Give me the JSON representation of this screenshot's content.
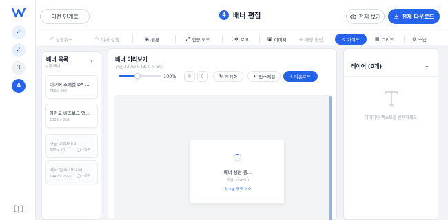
{
  "rail": {
    "steps": [
      {
        "label": "✓",
        "state": "done"
      },
      {
        "label": "✓",
        "state": "done"
      },
      {
        "label": "3",
        "state": "pending"
      },
      {
        "label": "4",
        "state": "active"
      }
    ]
  },
  "header": {
    "prev_label": "이전 단계로",
    "step_number": "4",
    "title": "배너 편집",
    "fullscreen_label": "전체 보기",
    "download_all_label": "전체 다운로드"
  },
  "toolbar": {
    "undo": "실행취소",
    "redo": "다시 실행",
    "original": "원본",
    "focus_mode": "집중 모드",
    "logo": "로고",
    "image": "이미지",
    "bg_edit": "배경 편집",
    "guide": "가이드",
    "grid": "그리드",
    "snap": "스냅"
  },
  "banner_list": {
    "title": "배너 목록",
    "count": "4개 배너",
    "items": [
      {
        "name": "네이버 스페셜 DA ...",
        "size": "750 x 280",
        "status": ""
      },
      {
        "name": "카카오 비즈보드 앱...",
        "size": "1029 x 258",
        "status": ""
      },
      {
        "name": "구글 320x50",
        "size": "320 x 50",
        "status": "~5분"
      },
      {
        "name": "메타 릴스 (9:16)",
        "size": "1440 x 2560",
        "status": "~5분"
      }
    ]
  },
  "preview": {
    "title": "배너 미리보기",
    "subtitle": "구글 320x50 (320 × 50)",
    "zoom_percent": "100%",
    "zoom_fraction": 0.45,
    "reset_label": "초기화",
    "upscale_label": "업스케일",
    "download_label": "다운로드",
    "loading_title": "배너 생성 중...",
    "loading_sub": "구글 320x50",
    "loading_eta": "약 5분 정도 소요"
  },
  "layers": {
    "title": "레이어 (0개)",
    "hint": "이미지나 텍스트를 선택하세요"
  },
  "colors": {
    "accent": "#2563eb"
  }
}
